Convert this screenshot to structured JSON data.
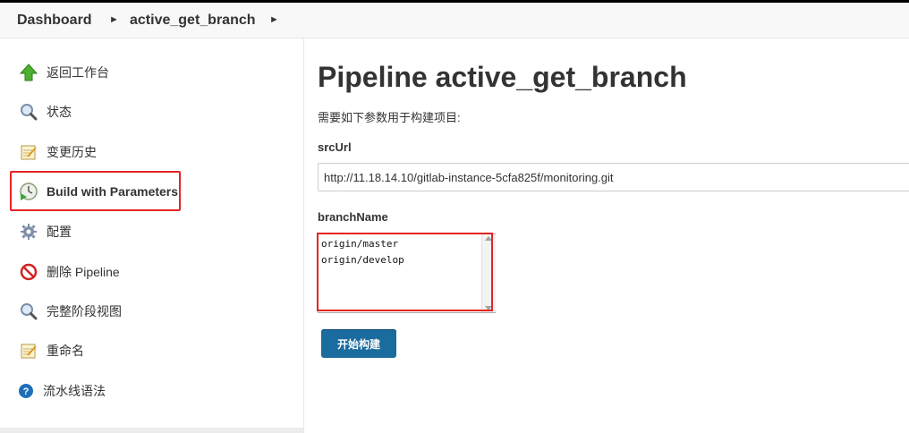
{
  "breadcrumb": {
    "items": [
      "Dashboard",
      "active_get_branch"
    ]
  },
  "sidebar": {
    "items": [
      {
        "label": "返回工作台",
        "icon": "up-arrow-icon"
      },
      {
        "label": "状态",
        "icon": "magnifier-icon"
      },
      {
        "label": "变更历史",
        "icon": "notepad-icon"
      },
      {
        "label": "Build with Parameters",
        "icon": "clock-play-icon"
      },
      {
        "label": "配置",
        "icon": "gear-icon"
      },
      {
        "label": "删除 Pipeline",
        "icon": "no-entry-icon"
      },
      {
        "label": "完整阶段视图",
        "icon": "magnifier-icon"
      },
      {
        "label": "重命名",
        "icon": "notepad-icon"
      },
      {
        "label": "流水线语法",
        "icon": "help-icon"
      }
    ]
  },
  "main": {
    "title": "Pipeline active_get_branch",
    "description": "需要如下参数用于构建项目:",
    "params": [
      {
        "name": "srcUrl",
        "value": "http://11.18.14.10/gitlab-instance-5cfa825f/monitoring.git"
      },
      {
        "name": "branchName",
        "value": "origin/master\norigin/develop"
      }
    ],
    "build_button": "开始构建"
  },
  "colors": {
    "highlight": "#e52424",
    "button": "#1a6b9e"
  }
}
